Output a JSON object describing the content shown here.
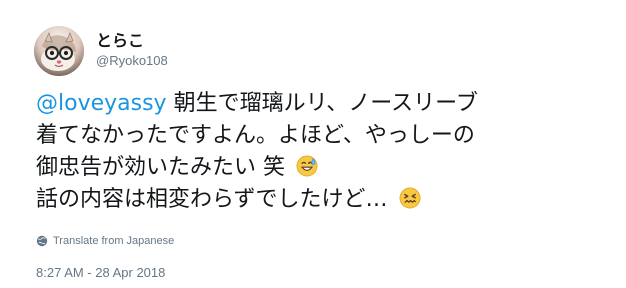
{
  "user": {
    "display_name": "とらこ",
    "handle": "@Ryoko108",
    "avatar_icon": "avatar-icon"
  },
  "tweet": {
    "mention": "@loveyassy",
    "line1_rest": "朝生で瑠璃ルリ、ノースリーブ",
    "line2": "着てなかったですよん。よほど、やっしーの",
    "line3": "御忠告が効いたみたい 笑",
    "line4": "話の内容は相変わらずでしたけど…",
    "emojis": [
      "sweat-smile-icon",
      "confounded-face-icon"
    ]
  },
  "translate": {
    "label": "Translate from Japanese",
    "icon": "globe-icon"
  },
  "timestamp": "8:27 AM - 28 Apr 2018",
  "colors": {
    "text": "#14171a",
    "secondary": "#657786",
    "link": "#1b95e0",
    "emoji_yellow": "#f7c843"
  }
}
